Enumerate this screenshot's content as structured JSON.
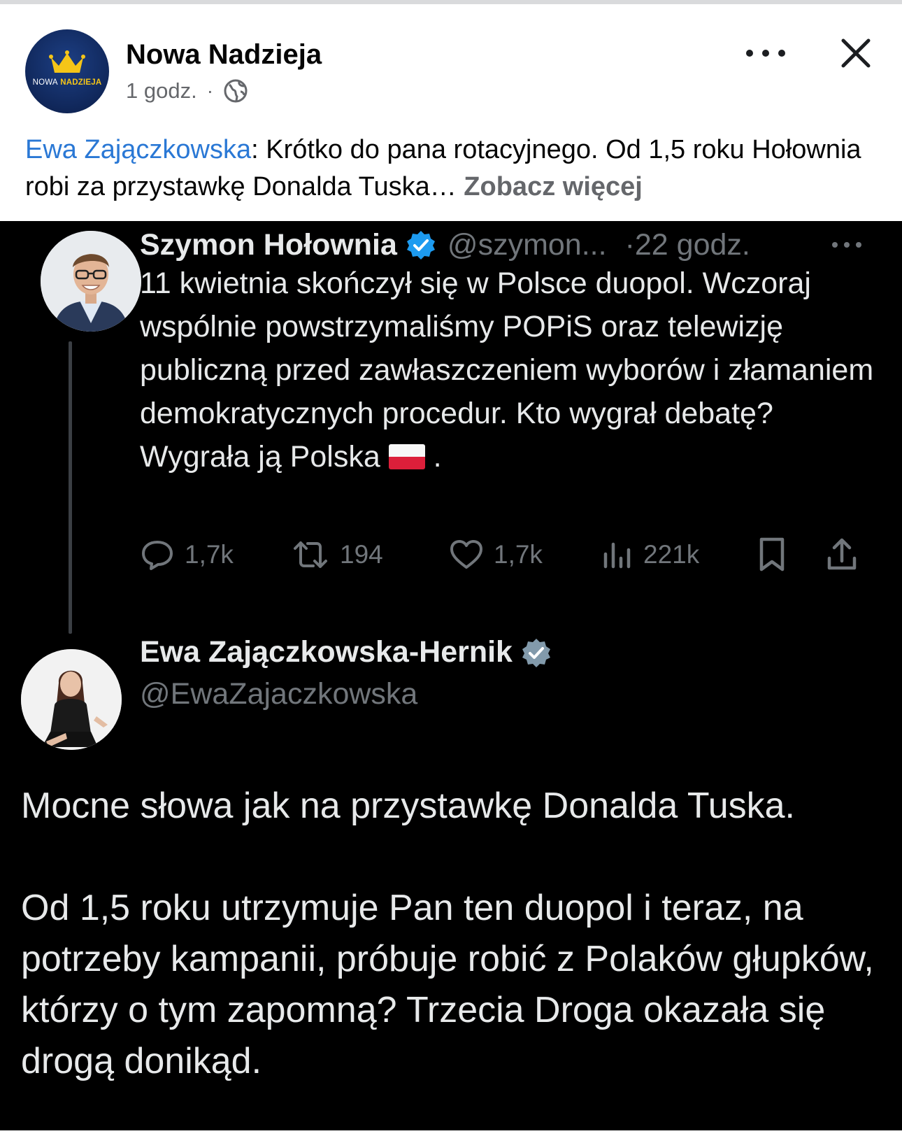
{
  "fb_post": {
    "page_name": "Nowa Nadzieja",
    "avatar_logo": {
      "part1": "NOWA",
      "part2": "NADZIEJA"
    },
    "time": "1 godz.",
    "separator": "·",
    "caption_author": "Ewa Zajączkowska",
    "caption_text": ": Krótko do pana rotacyjnego. Od 1,5 roku Hołownia robi za przystawkę Donalda Tuska…",
    "see_more": "Zobacz więcej",
    "icons": {
      "more": "more-options-icon",
      "close": "close-icon",
      "audience": "globe-icon"
    }
  },
  "tweet1": {
    "name": "Szymon Hołownia",
    "handle": "@szymon...",
    "time": "·22 godz.",
    "text": "11 kwietnia skończył się w Polsce duopol. Wczoraj wspólnie powstrzymaliśmy POPiS oraz telewizję publiczną przed zawłaszczeniem wyborów i złamaniem demokratycznych procedur. Kto wygrał debatę? Wygrała ją Polska ",
    "text_end": ".",
    "replies": "1,7k",
    "retweets": "194",
    "likes": "1,7k",
    "views": "221k"
  },
  "tweet2": {
    "name": "Ewa Zajączkowska-Hernik",
    "handle": "@EwaZajaczkowska",
    "paragraph1": "Mocne słowa jak na przystawkę Donalda Tuska.",
    "paragraph2": "Od 1,5 roku utrzymuje Pan ten duopol i teraz, na potrzeby kampanii, próbuje robić z Polaków głupków, którzy o tym zapomną? Trzecia Droga okazała się drogą donikąd."
  },
  "colors": {
    "link_blue": "#2a78d5",
    "fb_text": "#050505",
    "fb_secondary": "#65676b",
    "x_background": "#000000",
    "x_text": "#e7e9ea",
    "x_secondary": "#71767b",
    "verified_blue": "#1d9bf0",
    "verified_gray": "#829aab"
  }
}
